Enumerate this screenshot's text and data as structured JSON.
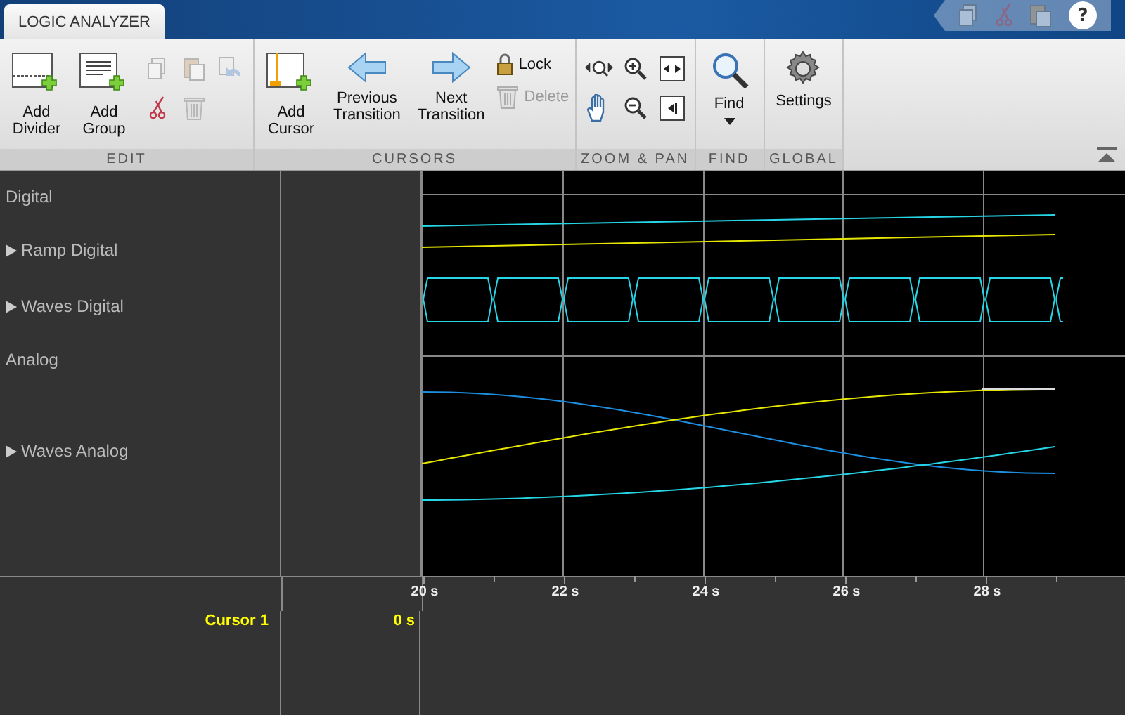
{
  "app_tab": {
    "label": "LOGIC ANALYZER",
    "selected": true
  },
  "quick_access": [
    {
      "disabled": true
    },
    {
      "disabled": true
    },
    {
      "disabled": true
    },
    {
      "disabled": false,
      "label": "?"
    }
  ],
  "toolbar": [
    {
      "title": "EDIT",
      "items": [
        {
          "kind": "large",
          "label": "Add\nDivider",
          "disabled": false
        },
        {
          "kind": "large",
          "label": "Add\nGroup",
          "disabled": false
        },
        {
          "kind": "small",
          "disabled": true
        },
        {
          "kind": "small",
          "disabled": true
        },
        {
          "kind": "small",
          "disabled": true
        },
        {
          "kind": "small",
          "disabled": false
        },
        {
          "kind": "small",
          "disabled": true
        }
      ]
    },
    {
      "title": "CURSORS",
      "items": [
        {
          "kind": "large",
          "label": "Add\nCursor",
          "disabled": false
        },
        {
          "kind": "large",
          "label": "Previous\nTransition",
          "disabled": false
        },
        {
          "kind": "large",
          "label": "Next\nTransition",
          "disabled": false
        },
        {
          "kind": "row",
          "label": "Lock",
          "disabled": false
        },
        {
          "kind": "row",
          "label": "Delete",
          "disabled": true
        }
      ]
    },
    {
      "title": "ZOOM & PAN",
      "items": [
        {
          "kind": "small",
          "disabled": false
        },
        {
          "kind": "small",
          "disabled": false
        },
        {
          "kind": "small",
          "disabled": false
        },
        {
          "kind": "small",
          "disabled": false
        },
        {
          "kind": "small",
          "disabled": false
        },
        {
          "kind": "small",
          "disabled": false
        }
      ]
    },
    {
      "title": "FIND",
      "items": [
        {
          "kind": "dropdown",
          "label": "Find",
          "disabled": false
        }
      ]
    },
    {
      "title": "GLOBAL",
      "items": [
        {
          "kind": "large",
          "label": "Settings",
          "disabled": false
        }
      ]
    }
  ],
  "signals": [
    {
      "kind": "divider",
      "label": "Digital"
    },
    {
      "kind": "signal",
      "label": "Ramp Digital",
      "expanded": false
    },
    {
      "kind": "signal",
      "label": "Waves Digital",
      "expanded": false
    },
    {
      "kind": "divider",
      "label": "Analog"
    },
    {
      "kind": "signal",
      "label": "Waves Analog",
      "expanded": false
    }
  ],
  "time_axis": {
    "ticks": [
      "20 s",
      "22 s",
      "24 s",
      "26 s",
      "28 s"
    ]
  },
  "cursors": [
    {
      "label": "Cursor 1",
      "value": "0 s",
      "color": "#ffff00"
    }
  ]
}
